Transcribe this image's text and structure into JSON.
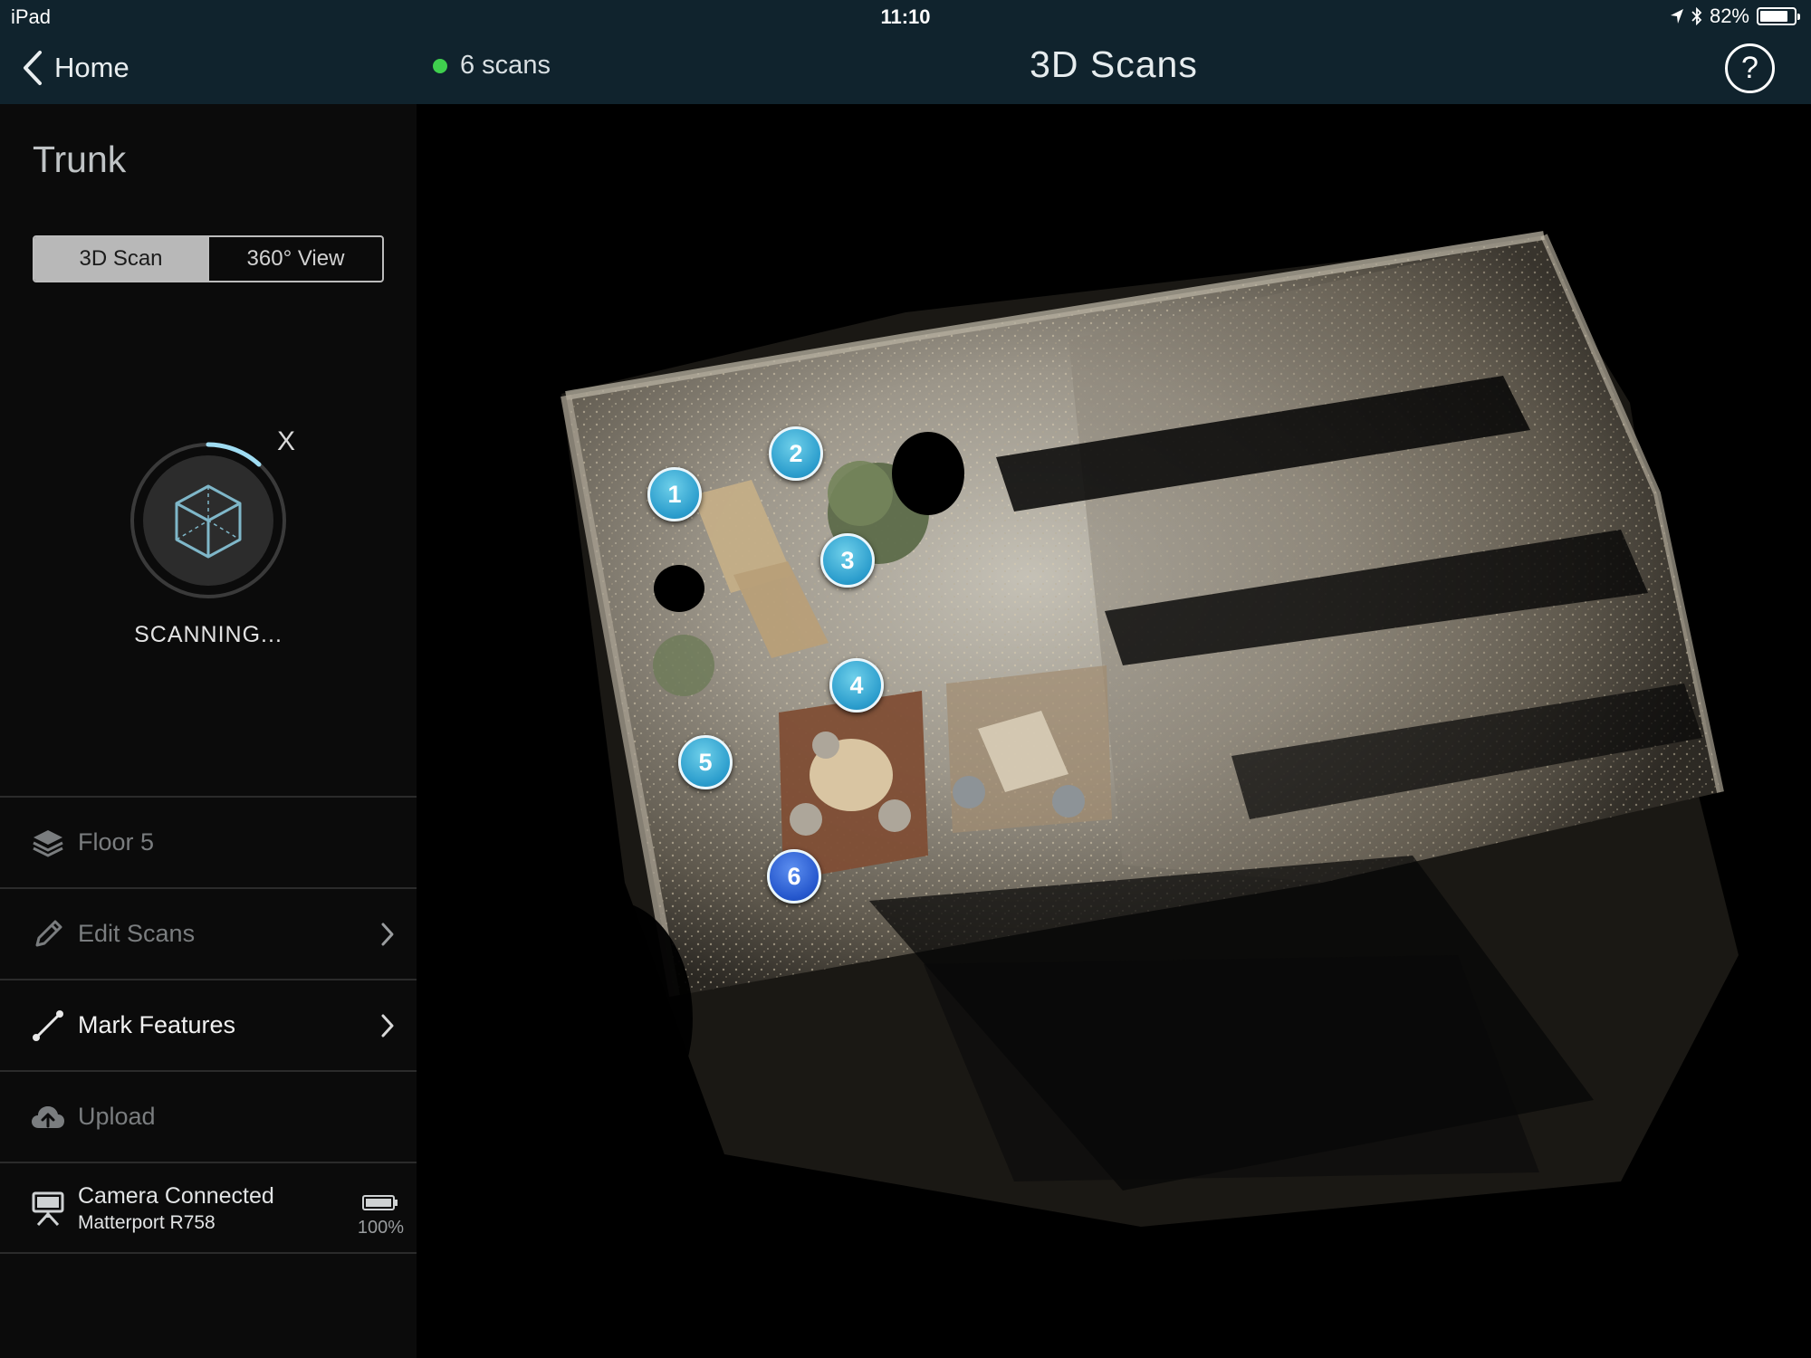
{
  "status_bar": {
    "device": "iPad",
    "time": "11:10",
    "battery": "82%"
  },
  "nav": {
    "back_label": "Home",
    "scan_count": "6 scans",
    "title": "3D Scans",
    "help_label": "?"
  },
  "sidebar": {
    "project_title": "Trunk",
    "view_modes": [
      "3D Scan",
      "360° View"
    ],
    "active_view_mode": "3D Scan",
    "scan_cancel_label": "X",
    "scanning_label": "SCANNING...",
    "menu": [
      {
        "label": "Floor 5",
        "icon": "layers-icon",
        "enabled": false
      },
      {
        "label": "Edit Scans",
        "icon": "pencil-icon",
        "enabled": false
      },
      {
        "label": "Mark Features",
        "icon": "measure-line-icon",
        "enabled": true
      },
      {
        "label": "Upload",
        "icon": "cloud-upload-icon",
        "enabled": false
      }
    ],
    "camera": {
      "status": "Camera Connected",
      "model": "Matterport R758",
      "battery": "100%"
    }
  },
  "viewport": {
    "scan_points": [
      "1",
      "2",
      "3",
      "4",
      "5",
      "6"
    ],
    "active_scan": "6"
  },
  "colors": {
    "nav_bg": "#10232d",
    "status_dot": "#3fcf4e",
    "pin_cyan": "#2a9ccc",
    "pin_active": "#2456cc"
  }
}
